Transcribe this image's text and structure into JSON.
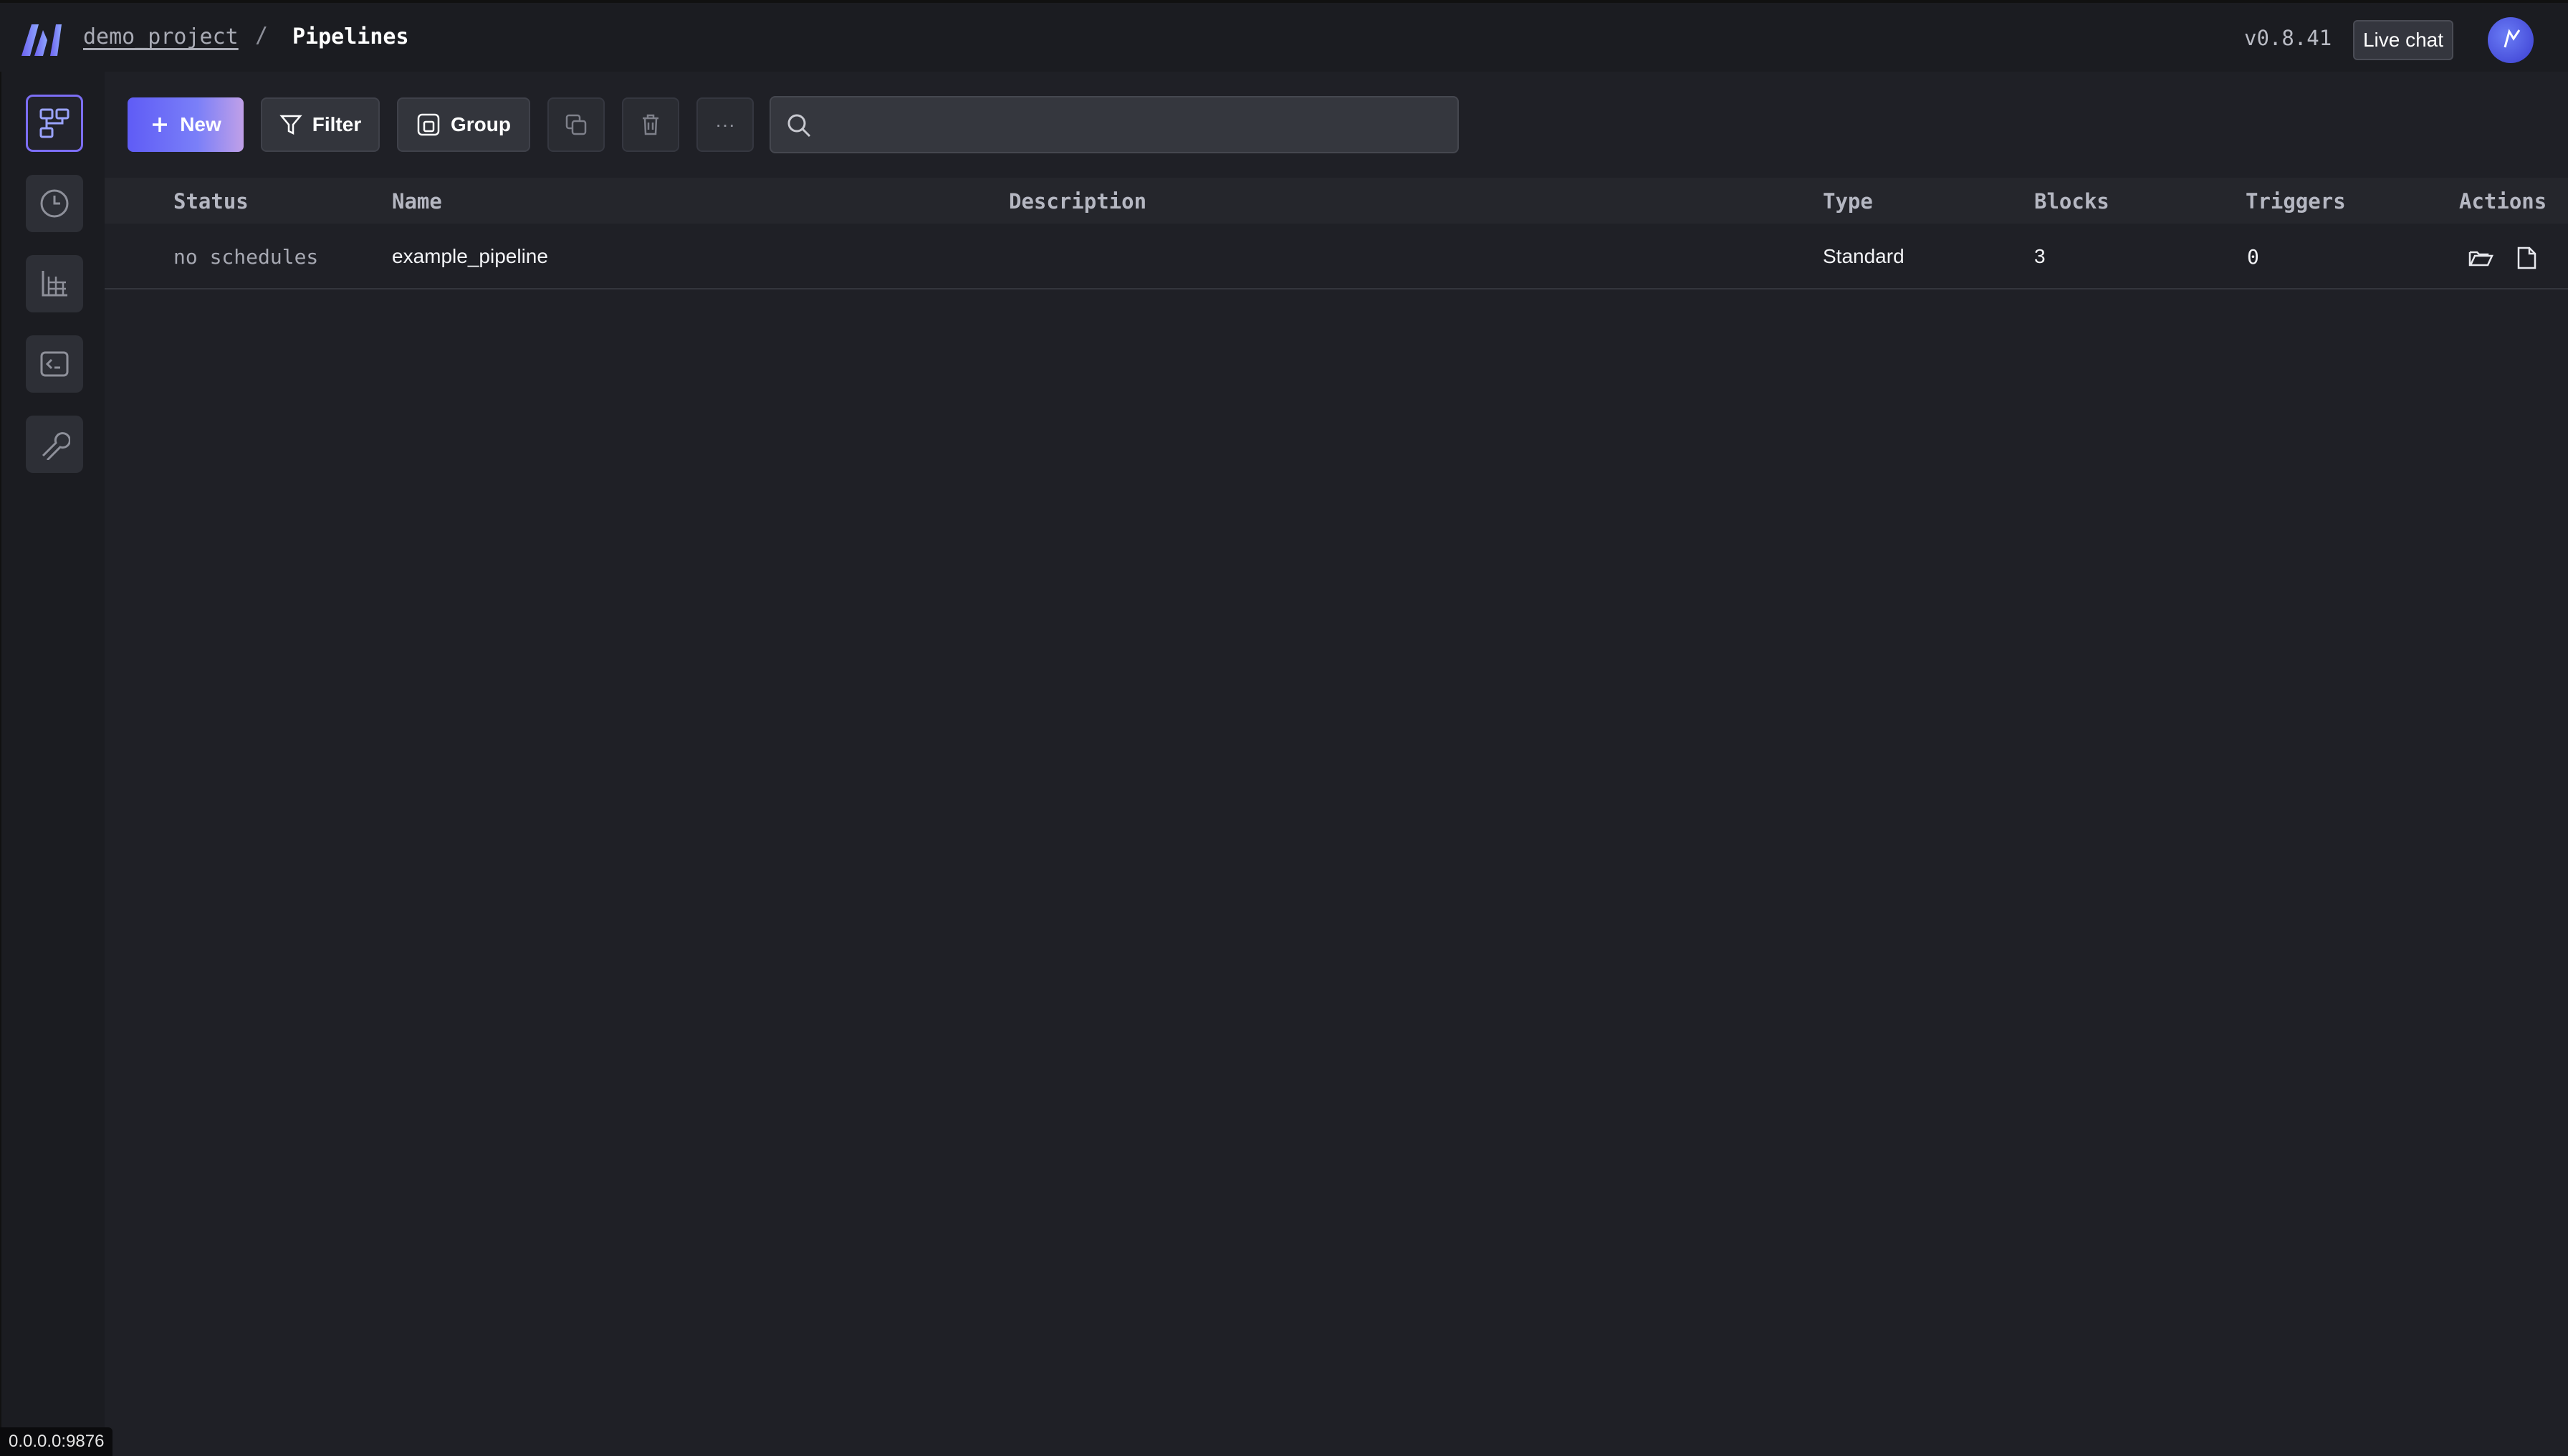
{
  "header": {
    "project": "demo_project",
    "separator": "/",
    "title": "Pipelines",
    "version": "v0.8.41",
    "live_chat": "Live chat"
  },
  "toolbar": {
    "new_label": "New",
    "filter_label": "Filter",
    "group_label": "Group",
    "more_label": "···",
    "search_placeholder": ""
  },
  "table": {
    "columns": [
      "Status",
      "Name",
      "Description",
      "Type",
      "Blocks",
      "Triggers",
      "Actions"
    ],
    "rows": [
      {
        "status": "no schedules",
        "name": "example_pipeline",
        "description": "",
        "type": "Standard",
        "blocks": "3",
        "triggers": "0"
      }
    ]
  },
  "footer": {
    "url": "0.0.0.0:9876"
  },
  "colors": {
    "background": "#1f2026",
    "accent": "#6a63f6",
    "active_border": "#7c6ef5"
  }
}
